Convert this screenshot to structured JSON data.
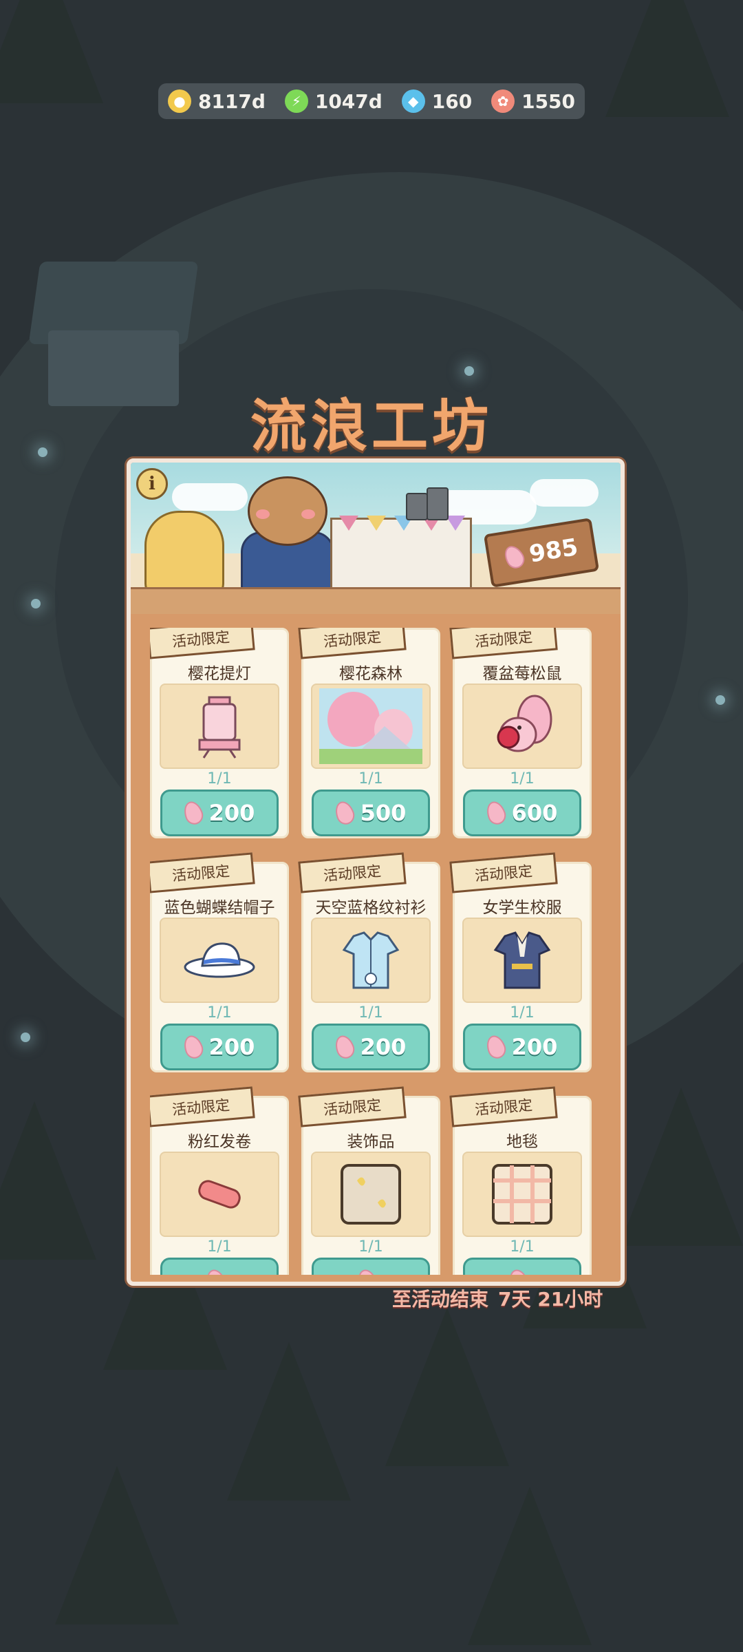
{
  "resources": [
    {
      "name": "coin",
      "value": "8117d",
      "color": "#f2c94c",
      "icon": "coin-icon"
    },
    {
      "name": "energy",
      "value": "1047d",
      "color": "#7ed957",
      "icon": "lightning-icon"
    },
    {
      "name": "gem",
      "value": "160",
      "color": "#5bc0eb",
      "icon": "gem-icon"
    },
    {
      "name": "candy",
      "value": "1550",
      "color": "#f08a7a",
      "icon": "candy-icon"
    }
  ],
  "title": "流浪工坊",
  "info_label": "i",
  "petal_balance": "985",
  "items": [
    {
      "tag": "活动限定",
      "name": "樱花提灯",
      "count": "1/1",
      "price": "200",
      "icon": "lantern-icon"
    },
    {
      "tag": "活动限定",
      "name": "樱花森林",
      "count": "1/1",
      "price": "500",
      "icon": "forest-icon"
    },
    {
      "tag": "活动限定",
      "name": "覆盆莓松鼠",
      "count": "1/1",
      "price": "600",
      "icon": "squirrel-icon"
    },
    {
      "tag": "活动限定",
      "name": "蓝色蝴蝶结帽子",
      "count": "1/1",
      "price": "200",
      "icon": "hat-icon"
    },
    {
      "tag": "活动限定",
      "name": "天空蓝格纹衬衫",
      "count": "1/1",
      "price": "200",
      "icon": "shirt-icon"
    },
    {
      "tag": "活动限定",
      "name": "女学生校服",
      "count": "1/1",
      "price": "200",
      "icon": "uniform-icon"
    },
    {
      "tag": "活动限定",
      "name": "粉红发卷",
      "count": "1/1",
      "price": "",
      "icon": "curler-icon"
    },
    {
      "tag": "活动限定",
      "name": "装饰品",
      "count": "1/1",
      "price": "",
      "icon": "ornament-icon"
    },
    {
      "tag": "活动限定",
      "name": "地毯",
      "count": "1/1",
      "price": "",
      "icon": "rug-icon"
    }
  ],
  "countdown": {
    "label": "至活动结束",
    "time": "7天 21小时"
  }
}
